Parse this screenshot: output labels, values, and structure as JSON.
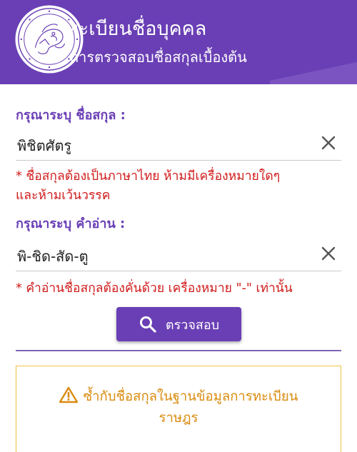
{
  "header": {
    "title": "ทะเบียนชื่อบุคคล",
    "subtitle": "การตรวจสอบชื่อสกุลเบื้องต้น"
  },
  "surname_field": {
    "label": "กรุณาระบุ ชื่อสกุล :",
    "value": "พิชิตศัตรู",
    "error_line1": "* ชื่อสกุลต้องเป็นภาษาไทย ห้ามมีเครื่องหมายใดๆ",
    "error_line2": "และห้ามเว้นวรรค"
  },
  "reading_field": {
    "label": "กรุณาระบุ คำอ่าน :",
    "value": "พิ-ชิด-สัด-ตู",
    "error": "* คำอ่านชื่อสกุลต้องคั่นด้วย เครื่องหมาย \"-\" เท่านั้น"
  },
  "check_button": {
    "label": "ตรวจสอบ",
    "icon": "search-icon"
  },
  "warning": {
    "icon": "warning-icon",
    "line1": "ซ้ำกับชื่อสกุลในฐานข้อมูลการทะเบียน",
    "line2": "ราษฎร"
  },
  "colors": {
    "primary": "#6a3fb5",
    "error": "#d01c1c",
    "warning_text": "#d98b0e",
    "warning_border": "#f0c542"
  }
}
